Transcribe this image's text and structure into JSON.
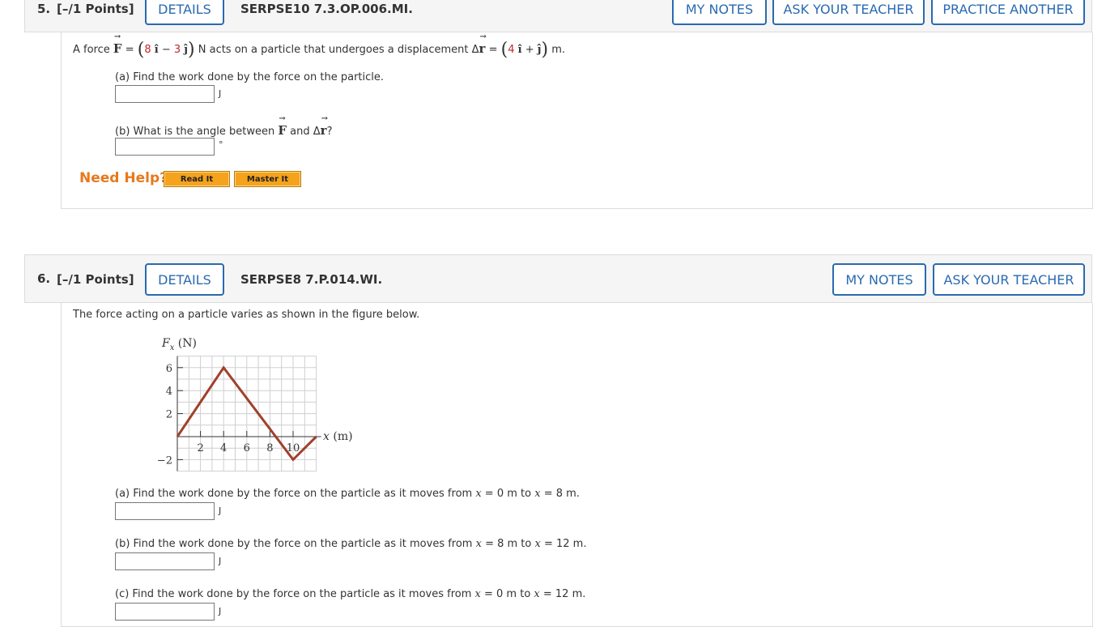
{
  "q5": {
    "number": "5.",
    "points": "[–/1 Points]",
    "details_label": "DETAILS",
    "code": "SERPSE10 7.3.OP.006.MI.",
    "my_notes_label": "MY NOTES",
    "ask_label": "ASK YOUR TEACHER",
    "practice_label": "PRACTICE ANOTHER",
    "stem": {
      "t1": "A force ",
      "F": "F",
      "eq1": " = ",
      "fx": "8",
      "ihat": "î",
      "minus": " − ",
      "fy": "3",
      "jhat": "ĵ",
      "t2": " N acts on a particle that undergoes a displacement ",
      "delta": "Δ",
      "r": "r",
      "eq2": " = ",
      "rx": "4",
      "plus": " + ",
      "t3": " m."
    },
    "part_a": "(a) Find the work done by the force on the particle.",
    "part_a_unit": "J",
    "part_b": {
      "t1": "(b) What is the angle between ",
      "F": "F",
      "and": " and ",
      "delta": "Δ",
      "r": "r",
      "q": "?"
    },
    "part_b_unit": "°",
    "need_help": "Need Help?",
    "read_it": "Read It",
    "master_it": "Master It"
  },
  "q6": {
    "number": "6.",
    "points": "[–/1 Points]",
    "details_label": "DETAILS",
    "code": "SERPSE8 7.P.014.WI.",
    "my_notes_label": "MY NOTES",
    "ask_label": "ASK YOUR TEACHER",
    "intro": "The force acting on a particle varies as shown in the figure below.",
    "parts": [
      {
        "pre": "(a) Find the work done by the force on the particle as it moves from ",
        "v1": "x",
        "mid1": " = 0 m to ",
        "v2": "x",
        "mid2": " = 8 m.",
        "unit": "J"
      },
      {
        "pre": "(b) Find the work done by the force on the particle as it moves from ",
        "v1": "x",
        "mid1": " = 8 m to ",
        "v2": "x",
        "mid2": " = 12 m.",
        "unit": "J"
      },
      {
        "pre": "(c) Find the work done by the force on the particle as it moves from ",
        "v1": "x",
        "mid1": " = 0 m to ",
        "v2": "x",
        "mid2": " = 12 m.",
        "unit": "J"
      }
    ]
  },
  "chart_data": {
    "type": "line",
    "ylabel_var": "F",
    "ylabel_sub": "x",
    "ylabel_unit": " (N)",
    "xlabel_var": "x",
    "xlabel_unit": " (m)",
    "x": [
      0,
      4,
      10,
      12
    ],
    "y": [
      0,
      6,
      -2,
      0
    ],
    "xlim": [
      0,
      12
    ],
    "ylim": [
      -3,
      7
    ],
    "xticks": [
      2,
      4,
      6,
      8,
      10
    ],
    "xtick_labels": [
      "2",
      "4",
      "6",
      "8",
      "10"
    ],
    "yticks": [
      6,
      4,
      2,
      -2
    ],
    "ytick_labels": [
      "6",
      "4",
      "2",
      "−2"
    ],
    "grid": true,
    "line_color": "#a0402c"
  }
}
